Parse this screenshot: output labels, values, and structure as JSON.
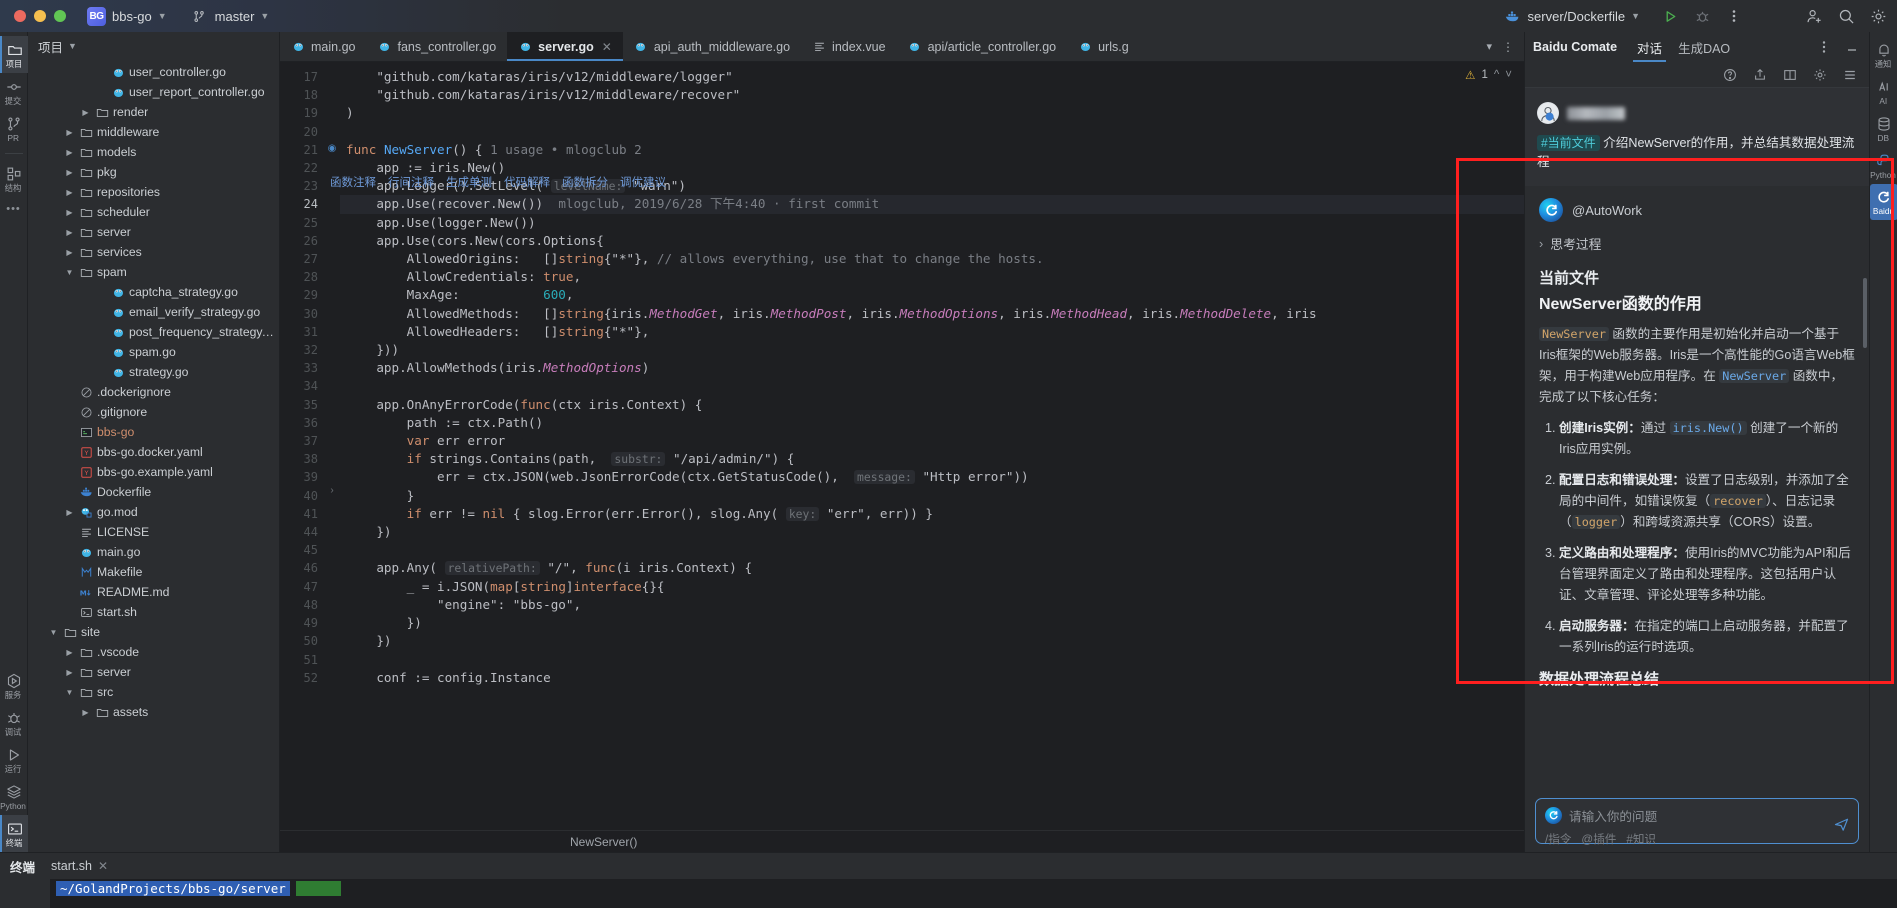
{
  "titlebar": {
    "project_badge": "BG",
    "project_name": "bbs-go",
    "branch": "master",
    "run_config": "server/Dockerfile",
    "icons": [
      "run-icon",
      "debug-icon",
      "more-vertical-icon",
      "add-user-icon",
      "search-icon",
      "gear-icon"
    ]
  },
  "left_strip": {
    "items": [
      {
        "label": "项目",
        "icon": "folder-icon",
        "active": true
      },
      {
        "label": "提交",
        "icon": "commit-icon",
        "active": false
      },
      {
        "label": "PR",
        "icon": "pull-request-icon",
        "active": false
      },
      {
        "label": "结构",
        "icon": "structure-icon",
        "active": false
      },
      {
        "label": "",
        "icon": "more-dots-icon",
        "active": false
      }
    ],
    "bottom_items": [
      {
        "label": "服务",
        "icon": "services-icon",
        "active": false
      },
      {
        "label": "调试",
        "icon": "bug-icon",
        "active": false
      },
      {
        "label": "运行",
        "icon": "play-icon",
        "active": false
      },
      {
        "label": "Python",
        "icon": "layers-icon",
        "active": false
      },
      {
        "label": "终端",
        "icon": "terminal-icon",
        "active": true
      }
    ]
  },
  "project_panel": {
    "title": "项目",
    "tree": [
      {
        "name": "user_controller.go",
        "icon": "go-file-icon",
        "indent": 4,
        "arrow": "none"
      },
      {
        "name": "user_report_controller.go",
        "icon": "go-file-icon",
        "indent": 4,
        "arrow": "none"
      },
      {
        "name": "render",
        "icon": "folder-icon",
        "indent": 3,
        "arrow": "collapsed"
      },
      {
        "name": "middleware",
        "icon": "folder-icon",
        "indent": 2,
        "arrow": "collapsed"
      },
      {
        "name": "models",
        "icon": "folder-icon",
        "indent": 2,
        "arrow": "collapsed"
      },
      {
        "name": "pkg",
        "icon": "folder-icon",
        "indent": 2,
        "arrow": "collapsed"
      },
      {
        "name": "repositories",
        "icon": "folder-icon",
        "indent": 2,
        "arrow": "collapsed"
      },
      {
        "name": "scheduler",
        "icon": "folder-icon",
        "indent": 2,
        "arrow": "collapsed"
      },
      {
        "name": "server",
        "icon": "folder-icon",
        "indent": 2,
        "arrow": "collapsed"
      },
      {
        "name": "services",
        "icon": "folder-icon",
        "indent": 2,
        "arrow": "collapsed"
      },
      {
        "name": "spam",
        "icon": "folder-icon",
        "indent": 2,
        "arrow": "expanded"
      },
      {
        "name": "captcha_strategy.go",
        "icon": "go-file-icon",
        "indent": 4,
        "arrow": "none"
      },
      {
        "name": "email_verify_strategy.go",
        "icon": "go-file-icon",
        "indent": 4,
        "arrow": "none"
      },
      {
        "name": "post_frequency_strategy.go",
        "icon": "go-file-icon",
        "indent": 4,
        "arrow": "none"
      },
      {
        "name": "spam.go",
        "icon": "go-file-icon",
        "indent": 4,
        "arrow": "none"
      },
      {
        "name": "strategy.go",
        "icon": "go-file-icon",
        "indent": 4,
        "arrow": "none"
      },
      {
        "name": ".dockerignore",
        "icon": "ignore-icon",
        "indent": 2,
        "arrow": "none"
      },
      {
        "name": ".gitignore",
        "icon": "ignore-icon",
        "indent": 2,
        "arrow": "none"
      },
      {
        "name": "bbs-go",
        "icon": "binary-icon",
        "indent": 2,
        "arrow": "none",
        "color": "orange"
      },
      {
        "name": "bbs-go.docker.yaml",
        "icon": "yaml-icon",
        "indent": 2,
        "arrow": "none"
      },
      {
        "name": "bbs-go.example.yaml",
        "icon": "yaml-icon",
        "indent": 2,
        "arrow": "none"
      },
      {
        "name": "Dockerfile",
        "icon": "docker-icon",
        "indent": 2,
        "arrow": "none"
      },
      {
        "name": "go.mod",
        "icon": "gomod-icon",
        "indent": 2,
        "arrow": "collapsed"
      },
      {
        "name": "LICENSE",
        "icon": "text-file-icon",
        "indent": 2,
        "arrow": "none"
      },
      {
        "name": "main.go",
        "icon": "go-file-icon",
        "indent": 2,
        "arrow": "none"
      },
      {
        "name": "Makefile",
        "icon": "makefile-icon",
        "indent": 2,
        "arrow": "none"
      },
      {
        "name": "README.md",
        "icon": "markdown-icon",
        "indent": 2,
        "arrow": "none"
      },
      {
        "name": "start.sh",
        "icon": "shell-icon",
        "indent": 2,
        "arrow": "none"
      },
      {
        "name": "site",
        "icon": "folder-icon",
        "indent": 1,
        "arrow": "expanded"
      },
      {
        "name": ".vscode",
        "icon": "folder-icon",
        "indent": 2,
        "arrow": "collapsed"
      },
      {
        "name": "server",
        "icon": "folder-icon",
        "indent": 2,
        "arrow": "collapsed"
      },
      {
        "name": "src",
        "icon": "folder-icon",
        "indent": 2,
        "arrow": "expanded"
      },
      {
        "name": "assets",
        "icon": "folder-icon",
        "indent": 3,
        "arrow": "collapsed"
      }
    ]
  },
  "editor": {
    "tabs": [
      {
        "label": "main.go",
        "icon": "go-file-icon",
        "active": false,
        "closable": false
      },
      {
        "label": "fans_controller.go",
        "icon": "go-file-icon",
        "active": false,
        "closable": false
      },
      {
        "label": "server.go",
        "icon": "go-file-icon",
        "active": true,
        "closable": true
      },
      {
        "label": "api_auth_middleware.go",
        "icon": "go-file-icon",
        "active": false,
        "closable": false
      },
      {
        "label": "index.vue",
        "icon": "vue-file-icon",
        "active": false,
        "closable": false
      },
      {
        "label": "api/article_controller.go",
        "icon": "go-file-icon",
        "active": false,
        "closable": false
      },
      {
        "label": "urls.g",
        "icon": "go-file-icon",
        "active": false,
        "closable": false
      }
    ],
    "warning_count": "1",
    "inspection_hints": [
      "函数注释",
      "行间注释",
      "生成单测",
      "代码解释",
      "函数拆分",
      "调优建议"
    ],
    "breadcrumb": "NewServer()",
    "highlighted_line": 24,
    "annotation": "mlogclub, 2019/6/28 下午4:40 · first commit",
    "usage_hint": "1 usage",
    "author_hint": "mlogclub 2",
    "lines": [
      {
        "n": 17,
        "code": "    \"github.com/kataras/iris/v12/middleware/logger\""
      },
      {
        "n": 18,
        "code": "    \"github.com/kataras/iris/v12/middleware/recover\""
      },
      {
        "n": 19,
        "code": ")"
      },
      {
        "n": 20,
        "code": ""
      },
      {
        "n": 21,
        "code": "func NewServer() {"
      },
      {
        "n": 22,
        "code": "    app := iris.New()"
      },
      {
        "n": 23,
        "code": "    app.Logger().SetLevel( levelName: \"warn\")"
      },
      {
        "n": 24,
        "code": "    app.Use(recover.New())"
      },
      {
        "n": 25,
        "code": "    app.Use(logger.New())"
      },
      {
        "n": 26,
        "code": "    app.Use(cors.New(cors.Options{"
      },
      {
        "n": 27,
        "code": "        AllowedOrigins:   []string{\"*\"}, // allows everything, use that to change the hosts."
      },
      {
        "n": 28,
        "code": "        AllowCredentials: true,"
      },
      {
        "n": 29,
        "code": "        MaxAge:           600,"
      },
      {
        "n": 30,
        "code": "        AllowedMethods:   []string{iris.MethodGet, iris.MethodPost, iris.MethodOptions, iris.MethodHead, iris.MethodDelete, iris"
      },
      {
        "n": 31,
        "code": "        AllowedHeaders:   []string{\"*\"},"
      },
      {
        "n": 32,
        "code": "    }))"
      },
      {
        "n": 33,
        "code": "    app.AllowMethods(iris.MethodOptions)"
      },
      {
        "n": 34,
        "code": ""
      },
      {
        "n": 35,
        "code": "    app.OnAnyErrorCode(func(ctx iris.Context) {"
      },
      {
        "n": 36,
        "code": "        path := ctx.Path()"
      },
      {
        "n": 37,
        "code": "        var err error"
      },
      {
        "n": 38,
        "code": "        if strings.Contains(path,  substr: \"/api/admin/\") {"
      },
      {
        "n": 39,
        "code": "            err = ctx.JSON(web.JsonErrorCode(ctx.GetStatusCode(),  message: \"Http error\"))"
      },
      {
        "n": 40,
        "code": "        }"
      },
      {
        "n": 41,
        "code": "        if err != nil { slog.Error(err.Error(), slog.Any( key: \"err\", err)) }"
      },
      {
        "n": 44,
        "code": "    })"
      },
      {
        "n": 45,
        "code": ""
      },
      {
        "n": 46,
        "code": "    app.Any( relativePath: \"/\", func(i iris.Context) {"
      },
      {
        "n": 47,
        "code": "        _ = i.JSON(map[string]interface{}{"
      },
      {
        "n": 48,
        "code": "            \"engine\": \"bbs-go\","
      },
      {
        "n": 49,
        "code": "        })"
      },
      {
        "n": 50,
        "code": "    })"
      },
      {
        "n": 51,
        "code": ""
      },
      {
        "n": 52,
        "code": "    conf := config.Instance"
      }
    ]
  },
  "ai_panel": {
    "title": "Baidu Comate",
    "tabs": [
      {
        "label": "对话",
        "active": true
      },
      {
        "label": "生成DAO",
        "active": false
      }
    ],
    "header_icons": [
      "more-vertical-icon",
      "minimize-icon"
    ],
    "toolbar_icons": [
      "help-icon",
      "share-icon",
      "split-icon",
      "settings-icon",
      "history-icon"
    ],
    "user_message": {
      "tag": "#当前文件",
      "text": "介绍NewServer的作用，并总结其数据处理流程"
    },
    "assistant": {
      "name": "@AutoWork",
      "thought_label": "思考过程",
      "section_title": "当前文件",
      "subtitle": "NewServer函数的作用",
      "paragraph_pre": "",
      "paragraph_code1": "NewServer",
      "paragraph_mid": " 函数的主要作用是初始化并启动一个基于Iris框架的Web服务器。Iris是一个高性能的Go语言Web框架，用于构建Web应用程序。在 ",
      "paragraph_code2": "NewServer",
      "paragraph_end": " 函数中，完成了以下核心任务：",
      "steps": [
        {
          "title": "创建Iris实例：",
          "body_pre": "通过 ",
          "code": "iris.New()",
          "body_post": " 创建了一个新的Iris应用实例。"
        },
        {
          "title": "配置日志和错误处理：",
          "body_pre": "设置了日志级别，并添加了全局的中间件，如错误恢复（",
          "code": "recover",
          "body_mid": "）、日志记录（",
          "code2": "logger",
          "body_post": "）和跨域资源共享（CORS）设置。"
        },
        {
          "title": "定义路由和处理程序：",
          "body_pre": "使用Iris的MVC功能为API和后台管理界面定义了路由和处理程序。这包括用户认证、文章管理、评论处理等多种功能。",
          "code": "",
          "body_post": ""
        },
        {
          "title": "启动服务器：",
          "body_pre": "在指定的端口上启动服务器，并配置了一系列Iris的运行时选项。",
          "code": "",
          "body_post": ""
        }
      ],
      "section2_title": "数据处理流程总结"
    },
    "input": {
      "placeholder": "请输入你的问题",
      "hints": [
        "/指令",
        "@插件",
        "#知识"
      ],
      "send_icon": "send-icon"
    }
  },
  "right_strip": {
    "items": [
      {
        "label": "通知",
        "icon": "bell-icon",
        "active": false
      },
      {
        "label": "AI",
        "icon": "ai-icon",
        "active": false
      },
      {
        "label": "DB",
        "icon": "database-icon",
        "active": false
      },
      {
        "label": "Python",
        "icon": "python-icon",
        "active": false
      },
      {
        "label": "Baidu",
        "icon": "comate-icon",
        "active": true
      }
    ]
  },
  "bottom_panel": {
    "tool_label": "终端",
    "tabs": [
      {
        "label": "start.sh",
        "active": true,
        "closable": true
      }
    ],
    "terminal_path": "~/GolandProjects/bbs-go/server"
  },
  "colors": {
    "accent": "#4a88c7",
    "annotation_red": "#ff1f1f",
    "tag_cyan": "#4ecbd8",
    "string_green": "#6aab73",
    "keyword_orange": "#cf8e6d"
  }
}
